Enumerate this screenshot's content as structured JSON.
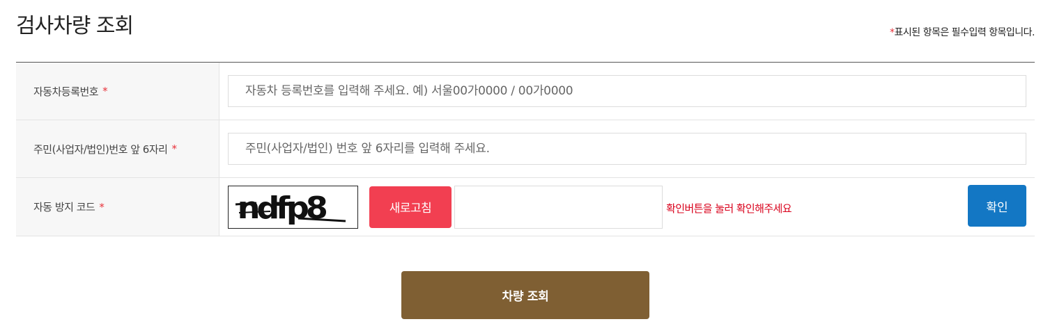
{
  "page": {
    "title": "검사차량 조회",
    "required_note_star": "*",
    "required_note": "표시된 항목은 필수입력 항목입니다."
  },
  "form": {
    "vehicle_number": {
      "label": "자동차등록번호",
      "required": "*",
      "placeholder": "자동차 등록번호를 입력해 주세요. 예) 서울00가0000 / 00가0000",
      "value": ""
    },
    "registration_number": {
      "label": "주민(사업자/법인)번호 앞 6자리",
      "required": "*",
      "placeholder": "주민(사업자/법인) 번호 앞 6자리를 입력해 주세요.",
      "value": ""
    },
    "captcha": {
      "label": "자동 방지 코드",
      "required": "*",
      "image_text": "ndfp8",
      "refresh_label": "새로고침",
      "value": "",
      "message": "확인버튼을 눌러 확인해주세요",
      "confirm_label": "확인"
    }
  },
  "actions": {
    "search_label": "차량 조회"
  },
  "colors": {
    "required_star": "#e8313a",
    "refresh_button": "#f23f51",
    "confirm_button": "#1377c4",
    "search_button": "#7f5f33",
    "message": "#d9001b"
  }
}
